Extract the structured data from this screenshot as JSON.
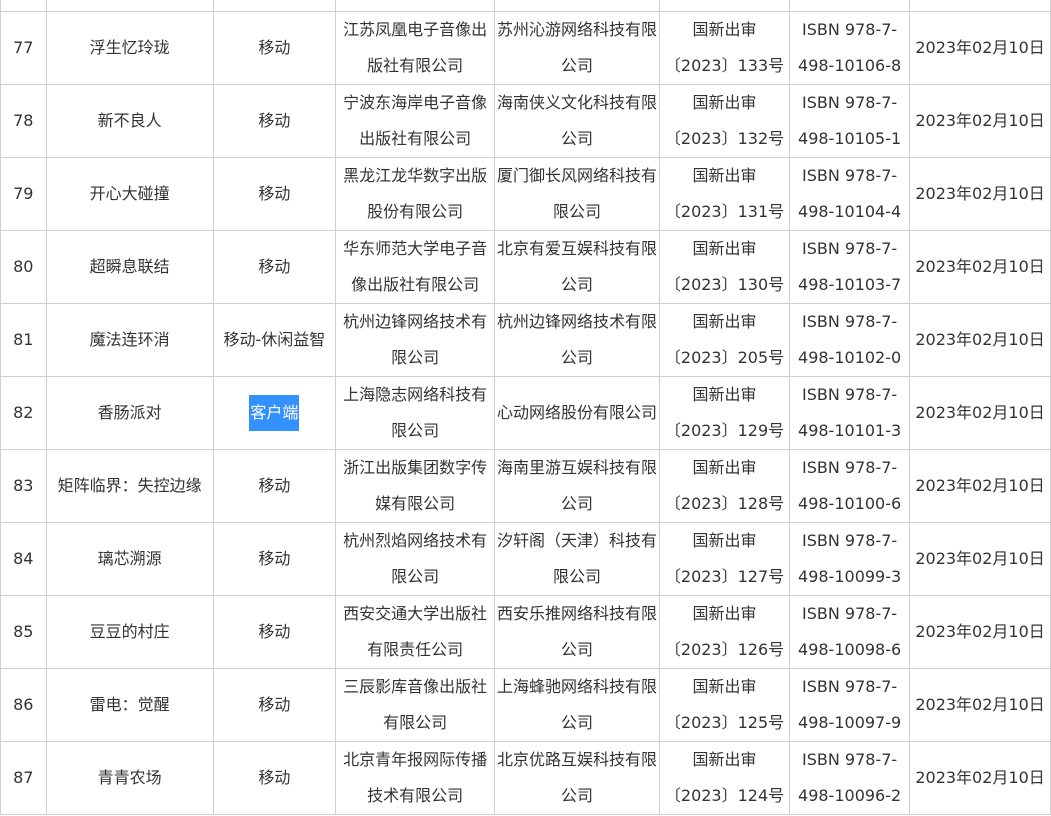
{
  "table": {
    "rows": [
      {
        "index": "",
        "name": "",
        "type": "",
        "publisher": "",
        "operator": "",
        "approval_a": "",
        "approval_b": "",
        "isbn_a": "",
        "isbn_b": "",
        "date": ""
      },
      {
        "index": "77",
        "name": "浮生忆玲珑",
        "type": "移动",
        "publisher": "江苏凤凰电子音像出版社有限公司",
        "operator": "苏州沁游网络科技有限公司",
        "approval_a": "国新出审",
        "approval_b": "〔2023〕133号",
        "isbn_a": "ISBN 978-7-",
        "isbn_b": "498-10106-8",
        "date": "2023年02月10日"
      },
      {
        "index": "78",
        "name": "新不良人",
        "type": "移动",
        "publisher": "宁波东海岸电子音像出版社有限公司",
        "operator": "海南侠义文化科技有限公司",
        "approval_a": "国新出审",
        "approval_b": "〔2023〕132号",
        "isbn_a": "ISBN 978-7-",
        "isbn_b": "498-10105-1",
        "date": "2023年02月10日"
      },
      {
        "index": "79",
        "name": "开心大碰撞",
        "type": "移动",
        "publisher": "黑龙江龙华数字出版股份有限公司",
        "operator": "厦门御长风网络科技有限公司",
        "approval_a": "国新出审",
        "approval_b": "〔2023〕131号",
        "isbn_a": "ISBN 978-7-",
        "isbn_b": "498-10104-4",
        "date": "2023年02月10日"
      },
      {
        "index": "80",
        "name": "超瞬息联结",
        "type": "移动",
        "publisher": "华东师范大学电子音像出版社有限公司",
        "operator": "北京有爱互娱科技有限公司",
        "approval_a": "国新出审",
        "approval_b": "〔2023〕130号",
        "isbn_a": "ISBN 978-7-",
        "isbn_b": "498-10103-7",
        "date": "2023年02月10日"
      },
      {
        "index": "81",
        "name": "魔法连环消",
        "type": "移动-休闲益智",
        "publisher": "杭州边锋网络技术有限公司",
        "operator": "杭州边锋网络技术有限公司",
        "approval_a": "国新出审",
        "approval_b": "〔2023〕205号",
        "isbn_a": "ISBN 978-7-",
        "isbn_b": "498-10102-0",
        "date": "2023年02月10日"
      },
      {
        "index": "82",
        "name": "香肠派对",
        "type": "客户端",
        "publisher": "上海隐志网络科技有限公司",
        "operator": "心动网络股份有限公司",
        "approval_a": "国新出审",
        "approval_b": "〔2023〕129号",
        "isbn_a": "ISBN 978-7-",
        "isbn_b": "498-10101-3",
        "date": "2023年02月10日"
      },
      {
        "index": "83",
        "name": "矩阵临界：失控边缘",
        "type": "移动",
        "publisher": "浙江出版集团数字传媒有限公司",
        "operator": "海南里游互娱科技有限公司",
        "approval_a": "国新出审",
        "approval_b": "〔2023〕128号",
        "isbn_a": "ISBN 978-7-",
        "isbn_b": "498-10100-6",
        "date": "2023年02月10日"
      },
      {
        "index": "84",
        "name": "璃芯溯源",
        "type": "移动",
        "publisher": "杭州烈焰网络技术有限公司",
        "operator": "汐轩阁（天津）科技有限公司",
        "approval_a": "国新出审",
        "approval_b": "〔2023〕127号",
        "isbn_a": "ISBN 978-7-",
        "isbn_b": "498-10099-3",
        "date": "2023年02月10日"
      },
      {
        "index": "85",
        "name": "豆豆的村庄",
        "type": "移动",
        "publisher": "西安交通大学出版社有限责任公司",
        "operator": "西安乐推网络科技有限公司",
        "approval_a": "国新出审",
        "approval_b": "〔2023〕126号",
        "isbn_a": "ISBN 978-7-",
        "isbn_b": "498-10098-6",
        "date": "2023年02月10日"
      },
      {
        "index": "86",
        "name": "雷电：觉醒",
        "type": "移动",
        "publisher": "三辰影库音像出版社有限公司",
        "operator": "上海蜂驰网络科技有限公司",
        "approval_a": "国新出审",
        "approval_b": "〔2023〕125号",
        "isbn_a": "ISBN 978-7-",
        "isbn_b": "498-10097-9",
        "date": "2023年02月10日"
      },
      {
        "index": "87",
        "name": "青青农场",
        "type": "移动",
        "publisher": "北京青年报网际传播技术有限公司",
        "operator": "北京优路互娱科技有限公司",
        "approval_a": "国新出审",
        "approval_b": "〔2023〕124号",
        "isbn_a": "ISBN 978-7-",
        "isbn_b": "498-10096-2",
        "date": "2023年02月10日"
      }
    ],
    "highlighted_row": 6,
    "colors": {
      "border": "#cfcfcf",
      "text": "#333333",
      "selection": "#3390ff"
    }
  }
}
